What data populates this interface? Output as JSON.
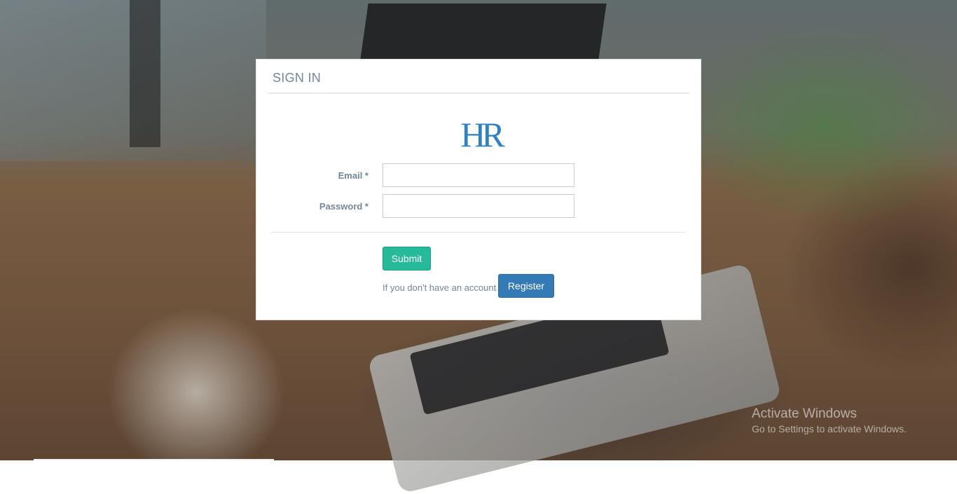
{
  "login_panel": {
    "title": "SIGN IN",
    "logo_text": "HR",
    "email_label": "Email *",
    "email_value": "",
    "password_label": "Password *",
    "password_value": "",
    "submit_label": "Submit",
    "account_prompt": "If you don't have an account",
    "register_label": "Register"
  },
  "windows_watermark": {
    "title": "Activate Windows",
    "subtitle": "Go to Settings to activate Windows."
  },
  "colors": {
    "logo_blue": "#2d82c7",
    "submit_green": "#26b99a",
    "register_blue": "#337ab7",
    "label_gray": "#73879c"
  },
  "icons": {
    "logo": "hr-logo"
  }
}
